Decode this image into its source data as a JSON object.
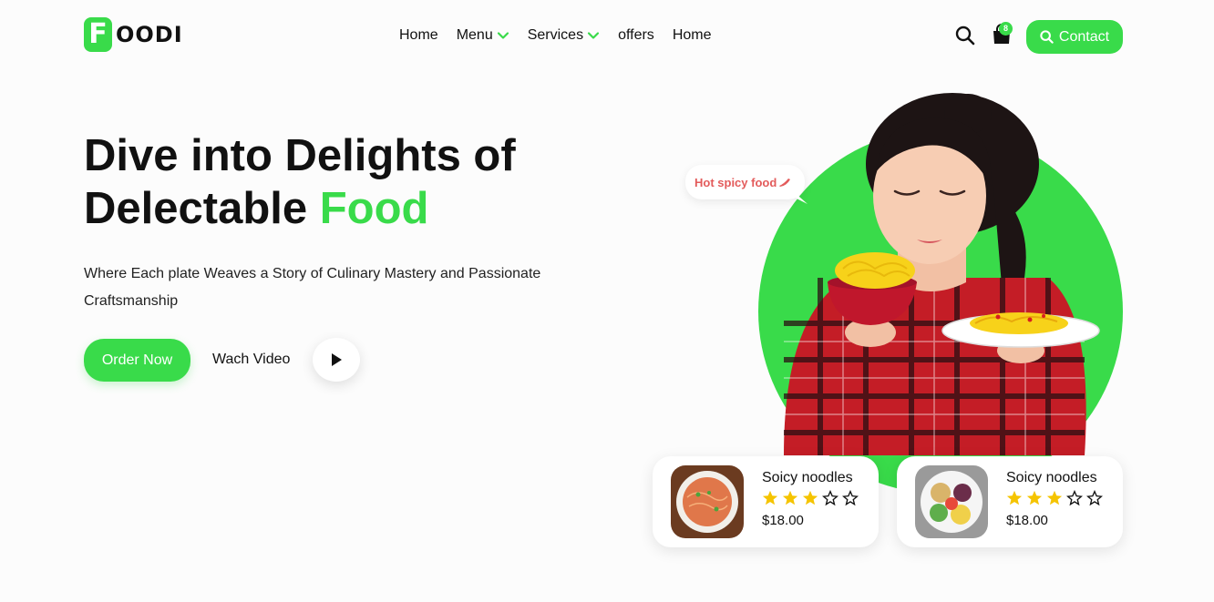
{
  "brand": {
    "logo_letter": "F",
    "logo_text": "OODI"
  },
  "nav": {
    "items": [
      {
        "label": "Home",
        "dropdown": false
      },
      {
        "label": "Menu",
        "dropdown": true
      },
      {
        "label": "Services",
        "dropdown": true
      },
      {
        "label": "offers",
        "dropdown": false
      },
      {
        "label": "Home",
        "dropdown": false
      }
    ],
    "cart_count": "8",
    "contact_label": "Contact"
  },
  "hero": {
    "title_line1": "Dive into Delights of",
    "title_line2_prefix": "Delectable ",
    "title_line2_accent": "Food",
    "subtitle": "Where Each plate Weaves a Story of Culinary Mastery and Passionate Craftsmanship",
    "order_label": "Order Now",
    "watch_label": "Wach Video",
    "bubble_text": "Hot spicy food"
  },
  "cards": [
    {
      "name": "Soicy noodles",
      "rating": 3,
      "max_rating": 5,
      "price": "$18.00"
    },
    {
      "name": "Soicy noodles",
      "rating": 3,
      "max_rating": 5,
      "price": "$18.00"
    }
  ],
  "colors": {
    "accent": "#39db4a",
    "bubble_text": "#e35b5b",
    "star": "#f5c400"
  }
}
